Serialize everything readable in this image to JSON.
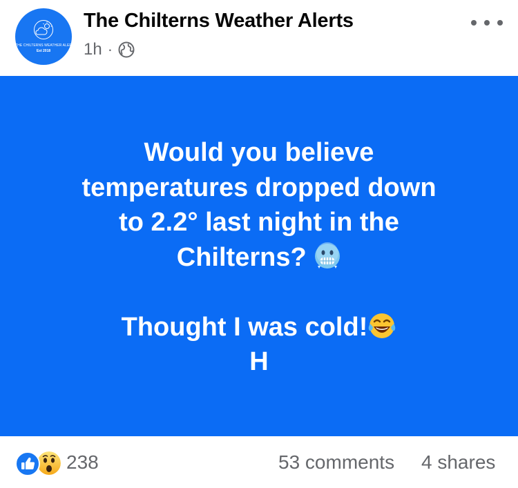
{
  "post": {
    "page_name": "The Chilterns Weather Alerts",
    "time_ago": "1h",
    "separator": "·",
    "audience_icon": "globe-icon",
    "more_icon": "more-horizontal-icon",
    "avatar": {
      "line1": "THE CHILTERNS WEATHER ALERTS",
      "line2": "Est 2018",
      "icon": "sun-cloud-icon",
      "color": "#1876f2"
    },
    "card": {
      "background_color": "#0b6cf5",
      "lines": [
        "Would you believe",
        "temperatures dropped down",
        "to 2.2° last night in the",
        "Chilterns?",
        "Thought I was cold!",
        "H"
      ],
      "emojis": [
        "cold-face-emoji",
        "laughing-tears-emoji"
      ]
    }
  },
  "footer": {
    "reaction_icons": [
      "like-icon",
      "wow-icon"
    ],
    "reaction_count": "238",
    "comments": "53 comments",
    "shares": "4 shares"
  }
}
